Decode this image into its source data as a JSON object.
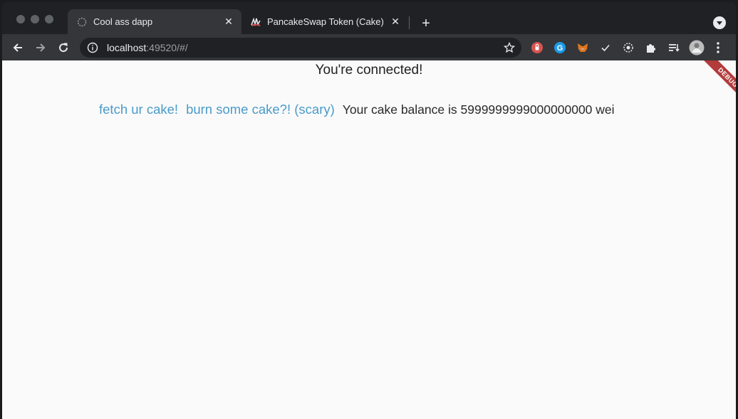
{
  "browser": {
    "tabs": [
      {
        "title": "Cool ass dapp",
        "active": true
      },
      {
        "title": "PancakeSwap Token (Cake) Tok",
        "active": false
      }
    ],
    "address": {
      "host": "localhost",
      "rest": ":49520/#/"
    },
    "extensions": [
      "lastpass-icon",
      "grammarly-icon",
      "metamask-icon",
      "check-icon",
      "gear-extension-icon",
      "puzzle-icon",
      "reading-list-icon",
      "profile-avatar"
    ]
  },
  "page": {
    "heading": "You're connected!",
    "fetch_link": "fetch ur cake!",
    "burn_link": "burn some cake?! (scary)",
    "balance_text": "Your cake balance is 5999999999000000000 wei",
    "debug_banner": "DEBUG"
  },
  "colors": {
    "link": "#4a9bc9",
    "debug_ribbon": "#b43b3b",
    "chrome_dark": "#202124",
    "toolbar": "#35363a"
  }
}
